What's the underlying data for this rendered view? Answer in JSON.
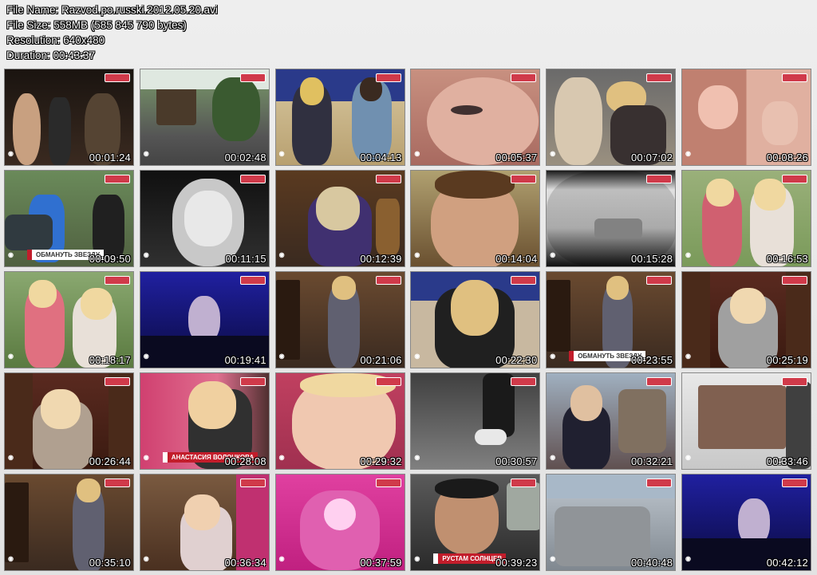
{
  "file_info": {
    "name_line": "File Name: Razvod.po.russki.2012.05.20.avi",
    "size_line": "File Size: 558MB (585 845 790 bytes)",
    "resolution_line": "Resolution: 640x480",
    "duration_line": "Duration: 00:43:37"
  },
  "thumbnails": [
    {
      "time": "00:01:24",
      "scene": "dark-night-people"
    },
    {
      "time": "00:02:48",
      "scene": "house-in-trees"
    },
    {
      "time": "00:04:13",
      "scene": "two-people-at-desk"
    },
    {
      "time": "00:05:37",
      "scene": "face-closeup"
    },
    {
      "time": "00:07:02",
      "scene": "woman-with-horse"
    },
    {
      "time": "00:08:26",
      "scene": "split-face-ring"
    },
    {
      "time": "00:09:50",
      "scene": "outdoor-interview",
      "caption": "ОБМАНУТЬ ЗВЕЗДУ"
    },
    {
      "time": "00:11:15",
      "scene": "bw-portrait"
    },
    {
      "time": "00:12:39",
      "scene": "man-interior-wood"
    },
    {
      "time": "00:14:04",
      "scene": "man-closeup"
    },
    {
      "time": "00:15:28",
      "scene": "car-on-street"
    },
    {
      "time": "00:16:53",
      "scene": "two-women-outdoor"
    },
    {
      "time": "00:18:17",
      "scene": "two-women-garden"
    },
    {
      "time": "00:19:41",
      "scene": "blue-stage"
    },
    {
      "time": "00:21:06",
      "scene": "man-standing-room"
    },
    {
      "time": "00:22:30",
      "scene": "man-suit-desk"
    },
    {
      "time": "00:23:55",
      "scene": "man-standing-room-caption",
      "caption": "ОБМАНУТЬ ЗВЕЗДУ"
    },
    {
      "time": "00:25:19",
      "scene": "woman-bookshelf"
    },
    {
      "time": "00:26:44",
      "scene": "woman-bookshelf-2"
    },
    {
      "time": "00:28:08",
      "scene": "blonde-pink-wall",
      "caption": "АНАСТАСИЯ ВОЛОЧКОВА"
    },
    {
      "time": "00:29:32",
      "scene": "blonde-closeup-pink"
    },
    {
      "time": "00:30:57",
      "scene": "feet-walking"
    },
    {
      "time": "00:32:21",
      "scene": "man-spiky-hair"
    },
    {
      "time": "00:33:46",
      "scene": "computer-screen"
    },
    {
      "time": "00:35:10",
      "scene": "man-standing-room-2"
    },
    {
      "time": "00:36:34",
      "scene": "woman-wardrobe"
    },
    {
      "time": "00:37:59",
      "scene": "pink-dress"
    },
    {
      "time": "00:39:23",
      "scene": "man-in-car",
      "caption": "РУСТАМ СОЛНЦЕВ"
    },
    {
      "time": "00:40:48",
      "scene": "silver-suv"
    },
    {
      "time": "00:42:12",
      "scene": "blue-stage-2"
    }
  ]
}
